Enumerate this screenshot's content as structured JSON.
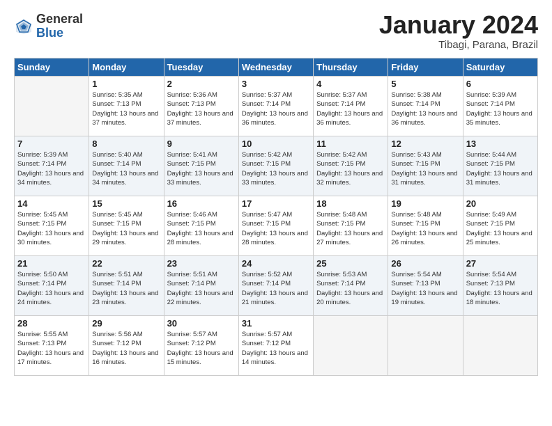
{
  "logo": {
    "general": "General",
    "blue": "Blue"
  },
  "title": {
    "month": "January 2024",
    "location": "Tibagi, Parana, Brazil"
  },
  "weekdays": [
    "Sunday",
    "Monday",
    "Tuesday",
    "Wednesday",
    "Thursday",
    "Friday",
    "Saturday"
  ],
  "weeks": [
    [
      {
        "day": "",
        "sunrise": "",
        "sunset": "",
        "daylight": ""
      },
      {
        "day": "1",
        "sunrise": "Sunrise: 5:35 AM",
        "sunset": "Sunset: 7:13 PM",
        "daylight": "Daylight: 13 hours and 37 minutes."
      },
      {
        "day": "2",
        "sunrise": "Sunrise: 5:36 AM",
        "sunset": "Sunset: 7:13 PM",
        "daylight": "Daylight: 13 hours and 37 minutes."
      },
      {
        "day": "3",
        "sunrise": "Sunrise: 5:37 AM",
        "sunset": "Sunset: 7:14 PM",
        "daylight": "Daylight: 13 hours and 36 minutes."
      },
      {
        "day": "4",
        "sunrise": "Sunrise: 5:37 AM",
        "sunset": "Sunset: 7:14 PM",
        "daylight": "Daylight: 13 hours and 36 minutes."
      },
      {
        "day": "5",
        "sunrise": "Sunrise: 5:38 AM",
        "sunset": "Sunset: 7:14 PM",
        "daylight": "Daylight: 13 hours and 36 minutes."
      },
      {
        "day": "6",
        "sunrise": "Sunrise: 5:39 AM",
        "sunset": "Sunset: 7:14 PM",
        "daylight": "Daylight: 13 hours and 35 minutes."
      }
    ],
    [
      {
        "day": "7",
        "sunrise": "Sunrise: 5:39 AM",
        "sunset": "Sunset: 7:14 PM",
        "daylight": "Daylight: 13 hours and 34 minutes."
      },
      {
        "day": "8",
        "sunrise": "Sunrise: 5:40 AM",
        "sunset": "Sunset: 7:14 PM",
        "daylight": "Daylight: 13 hours and 34 minutes."
      },
      {
        "day": "9",
        "sunrise": "Sunrise: 5:41 AM",
        "sunset": "Sunset: 7:15 PM",
        "daylight": "Daylight: 13 hours and 33 minutes."
      },
      {
        "day": "10",
        "sunrise": "Sunrise: 5:42 AM",
        "sunset": "Sunset: 7:15 PM",
        "daylight": "Daylight: 13 hours and 33 minutes."
      },
      {
        "day": "11",
        "sunrise": "Sunrise: 5:42 AM",
        "sunset": "Sunset: 7:15 PM",
        "daylight": "Daylight: 13 hours and 32 minutes."
      },
      {
        "day": "12",
        "sunrise": "Sunrise: 5:43 AM",
        "sunset": "Sunset: 7:15 PM",
        "daylight": "Daylight: 13 hours and 31 minutes."
      },
      {
        "day": "13",
        "sunrise": "Sunrise: 5:44 AM",
        "sunset": "Sunset: 7:15 PM",
        "daylight": "Daylight: 13 hours and 31 minutes."
      }
    ],
    [
      {
        "day": "14",
        "sunrise": "Sunrise: 5:45 AM",
        "sunset": "Sunset: 7:15 PM",
        "daylight": "Daylight: 13 hours and 30 minutes."
      },
      {
        "day": "15",
        "sunrise": "Sunrise: 5:45 AM",
        "sunset": "Sunset: 7:15 PM",
        "daylight": "Daylight: 13 hours and 29 minutes."
      },
      {
        "day": "16",
        "sunrise": "Sunrise: 5:46 AM",
        "sunset": "Sunset: 7:15 PM",
        "daylight": "Daylight: 13 hours and 28 minutes."
      },
      {
        "day": "17",
        "sunrise": "Sunrise: 5:47 AM",
        "sunset": "Sunset: 7:15 PM",
        "daylight": "Daylight: 13 hours and 28 minutes."
      },
      {
        "day": "18",
        "sunrise": "Sunrise: 5:48 AM",
        "sunset": "Sunset: 7:15 PM",
        "daylight": "Daylight: 13 hours and 27 minutes."
      },
      {
        "day": "19",
        "sunrise": "Sunrise: 5:48 AM",
        "sunset": "Sunset: 7:15 PM",
        "daylight": "Daylight: 13 hours and 26 minutes."
      },
      {
        "day": "20",
        "sunrise": "Sunrise: 5:49 AM",
        "sunset": "Sunset: 7:15 PM",
        "daylight": "Daylight: 13 hours and 25 minutes."
      }
    ],
    [
      {
        "day": "21",
        "sunrise": "Sunrise: 5:50 AM",
        "sunset": "Sunset: 7:14 PM",
        "daylight": "Daylight: 13 hours and 24 minutes."
      },
      {
        "day": "22",
        "sunrise": "Sunrise: 5:51 AM",
        "sunset": "Sunset: 7:14 PM",
        "daylight": "Daylight: 13 hours and 23 minutes."
      },
      {
        "day": "23",
        "sunrise": "Sunrise: 5:51 AM",
        "sunset": "Sunset: 7:14 PM",
        "daylight": "Daylight: 13 hours and 22 minutes."
      },
      {
        "day": "24",
        "sunrise": "Sunrise: 5:52 AM",
        "sunset": "Sunset: 7:14 PM",
        "daylight": "Daylight: 13 hours and 21 minutes."
      },
      {
        "day": "25",
        "sunrise": "Sunrise: 5:53 AM",
        "sunset": "Sunset: 7:14 PM",
        "daylight": "Daylight: 13 hours and 20 minutes."
      },
      {
        "day": "26",
        "sunrise": "Sunrise: 5:54 AM",
        "sunset": "Sunset: 7:13 PM",
        "daylight": "Daylight: 13 hours and 19 minutes."
      },
      {
        "day": "27",
        "sunrise": "Sunrise: 5:54 AM",
        "sunset": "Sunset: 7:13 PM",
        "daylight": "Daylight: 13 hours and 18 minutes."
      }
    ],
    [
      {
        "day": "28",
        "sunrise": "Sunrise: 5:55 AM",
        "sunset": "Sunset: 7:13 PM",
        "daylight": "Daylight: 13 hours and 17 minutes."
      },
      {
        "day": "29",
        "sunrise": "Sunrise: 5:56 AM",
        "sunset": "Sunset: 7:12 PM",
        "daylight": "Daylight: 13 hours and 16 minutes."
      },
      {
        "day": "30",
        "sunrise": "Sunrise: 5:57 AM",
        "sunset": "Sunset: 7:12 PM",
        "daylight": "Daylight: 13 hours and 15 minutes."
      },
      {
        "day": "31",
        "sunrise": "Sunrise: 5:57 AM",
        "sunset": "Sunset: 7:12 PM",
        "daylight": "Daylight: 13 hours and 14 minutes."
      },
      {
        "day": "",
        "sunrise": "",
        "sunset": "",
        "daylight": ""
      },
      {
        "day": "",
        "sunrise": "",
        "sunset": "",
        "daylight": ""
      },
      {
        "day": "",
        "sunrise": "",
        "sunset": "",
        "daylight": ""
      }
    ]
  ]
}
